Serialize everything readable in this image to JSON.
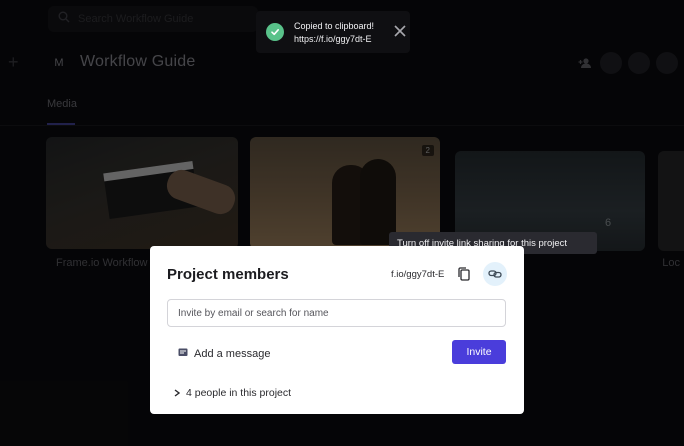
{
  "toast": {
    "title": "Copied to clipboard!",
    "url": "https://f.io/ggy7dt-E"
  },
  "header": {
    "search_placeholder": "Search Workflow Guide",
    "workspace_initial": "M",
    "project_title": "Workflow Guide"
  },
  "tabs": {
    "media": "Media"
  },
  "cards": [
    {
      "title": "Frame.io Workflow"
    },
    {
      "badge": "2"
    },
    {
      "count": "6"
    },
    {
      "title": "Loc"
    }
  ],
  "tooltip": {
    "text": "Turn off invite link sharing for this project"
  },
  "modal": {
    "title": "Project members",
    "invite_link": "f.io/ggy7dt-E",
    "invite_placeholder": "Invite by email or search for name",
    "add_message_label": "Add a message",
    "invite_button": "Invite",
    "people_summary": "4 people in this project"
  },
  "colors": {
    "accent": "#4a3ddb",
    "toast_success": "#59c28a",
    "link_button_bg": "#e3f1fb"
  }
}
